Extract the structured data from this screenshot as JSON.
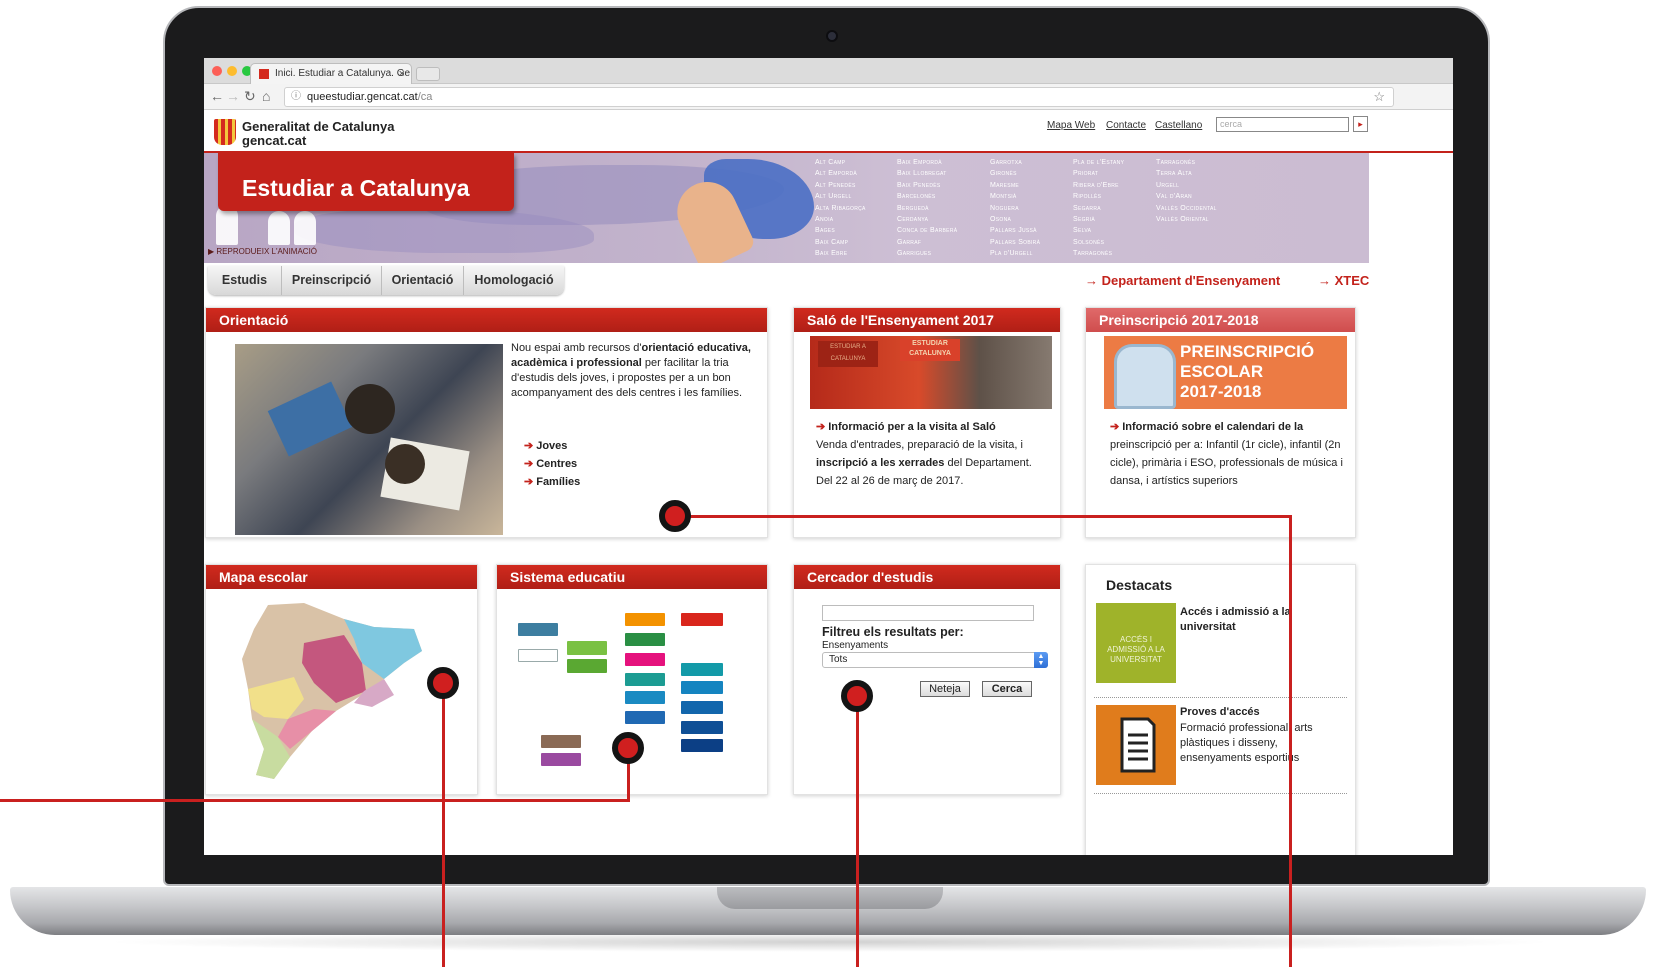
{
  "browser": {
    "tab_title": "Inici. Estudiar a Catalunya. Ge",
    "tab_close": "×",
    "url_host": "queestudiar.gencat.cat",
    "url_path": "/ca",
    "info_icon": "info-icon",
    "star_icon": "star-icon",
    "dots_colors": [
      "#fc5f57",
      "#fdbc2e",
      "#28c840"
    ]
  },
  "header": {
    "org_name": "Generalitat de Catalunya",
    "org_url": "gencat.cat",
    "links": [
      "Mapa Web",
      "Contacte",
      "Castellano"
    ],
    "search_placeholder": "cerca",
    "search_button": "▸"
  },
  "banner": {
    "title": "Estudiar a Catalunya",
    "animation_link": "▶ REPRODUEIX L'ANIMACIÓ",
    "regions": [
      [
        "Alt Camp",
        "Alt Empordà",
        "Alt Penedès",
        "Alt Urgell",
        "Alta Ribagorça",
        "Anoia",
        "Bages",
        "Baix Camp",
        "Baix Ebre"
      ],
      [
        "Baix Empordà",
        "Baix Llobregat",
        "Baix Penedès",
        "Barcelonès",
        "Berguedà",
        "Cerdanya",
        "Conca de Barberà",
        "Garraf",
        "Garrigues"
      ],
      [
        "Garrotxa",
        "Gironès",
        "Maresme",
        "Montsià",
        "Noguera",
        "Osona",
        "Pallars Jussà",
        "Pallars Sobirà",
        "Pla d'Urgell"
      ],
      [
        "Pla de l'Estany",
        "Priorat",
        "Ribera d'Ebre",
        "Ripollès",
        "Segarra",
        "Segrià",
        "Selva",
        "Solsonès",
        "Tarragonès"
      ],
      [
        "Tarragonès",
        "Terra Alta",
        "Urgell",
        "Val d'Aran",
        "Vallès Occidental",
        "Vallès Oriental"
      ]
    ]
  },
  "nav": {
    "items": [
      "Estudis",
      "Preinscripció",
      "Orientació",
      "Homologació"
    ],
    "dept_link": "→ Departament d'Ensenyament",
    "xtec_link": "→ XTEC"
  },
  "orientacio": {
    "title": "Orientació",
    "text_1": "Nou espai amb recursos d'",
    "text_bold_1": "orientació educativa, acadèmica i professional",
    "text_2": " per facilitar la tria d'estudis dels joves, i propostes per a un bon acompanyament des dels centres i les famílies.",
    "arrow": "➔",
    "links": [
      "Joves",
      "Centres",
      "Famílies"
    ]
  },
  "salo": {
    "title": "Saló de l'Ensenyament 2017",
    "sign_1": "ESTUDIAR A CATALUNYA",
    "sign_2": "ESTUDIAR CATALUNYA",
    "link": "Informació per a la visita al Saló",
    "text_1": "Venda d'entrades, preparació de la visita, i ",
    "text_bold": "inscripció a les xerrades",
    "text_2": " del Departament.",
    "dates": "Del 22 al 26 de març de 2017."
  },
  "preinscripcio": {
    "title": "Preinscripció 2017-2018",
    "image_text": [
      "PREINSCRIPCIÓ",
      "ESCOLAR",
      "2017-2018"
    ],
    "link": "Informació sobre el calendari de la",
    "text": "preinscripció per a: Infantil (1r cicle), infantil (2n cicle), primària i ESO, professionals de música i dansa, i artístics superiors"
  },
  "mapa": {
    "title": "Mapa escolar"
  },
  "sistema": {
    "title": "Sistema educatiu"
  },
  "cercador": {
    "title": "Cercador d'estudis",
    "filter_title": "Filtreu els resultats per:",
    "select_label": "Ensenyaments",
    "select_value": "Tots",
    "btn_clear": "Neteja",
    "btn_search": "Cerca"
  },
  "destacats": {
    "title": "Destacats",
    "items": [
      {
        "image_text": "ACCÉS I ADMISSIÓ A LA UNIVERSITAT",
        "title": "Accés i admissió a la universitat",
        "text": ""
      },
      {
        "image_text": "",
        "title": "Proves d'accés",
        "text": "Formació professional, arts plàstiques i disseny, ensenyaments esportius"
      }
    ]
  },
  "colors": {
    "brand_red": "#c3221b",
    "callout_red": "#d01f1f"
  }
}
